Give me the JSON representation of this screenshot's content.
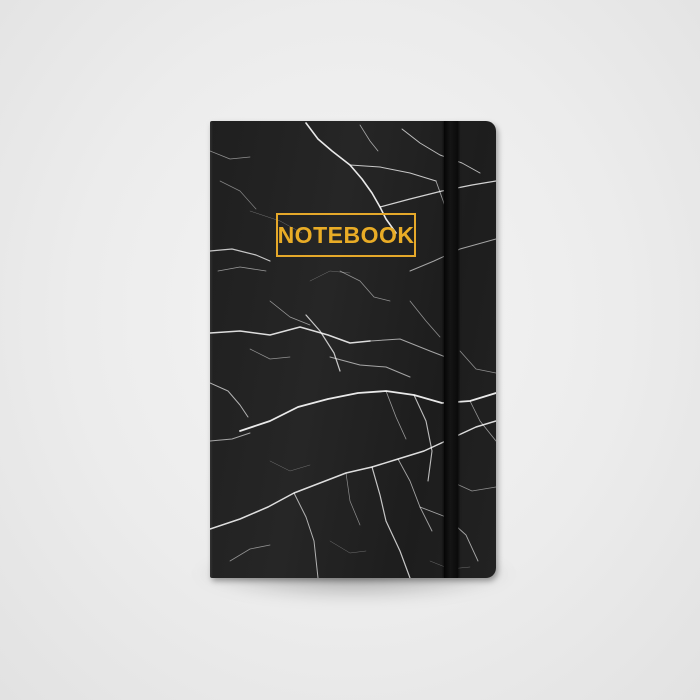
{
  "product": {
    "cover_title": "NOTEBOOK",
    "colors": {
      "cover": "#222222",
      "veins": "#ffffff",
      "title_gold": "#e9ac26",
      "band": "#0d0d0d",
      "background": "#ececec"
    },
    "icons": [
      "marble-vein-texture",
      "elastic-band"
    ]
  }
}
